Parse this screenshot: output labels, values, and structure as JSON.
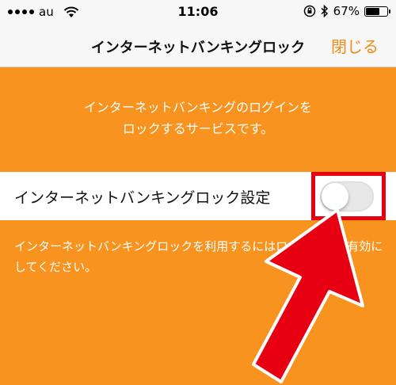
{
  "status_bar": {
    "carrier": "au",
    "time": "11:06",
    "battery_percent": "67%",
    "battery_level": 0.67,
    "icons": [
      "signal-icon",
      "wifi-icon",
      "orientation-lock-icon",
      "bluetooth-icon",
      "battery-icon"
    ]
  },
  "nav": {
    "title": "インターネットバンキングロック",
    "close_label": "閉じる"
  },
  "description": {
    "line1": "インターネットバンキングのログインを",
    "line2": "ロックするサービスです。"
  },
  "setting": {
    "label": "インターネットバンキングロック設定",
    "enabled": false
  },
  "note": {
    "text": "インターネットバンキングロックを利用するにはロック設定を有効にしてください。"
  },
  "colors": {
    "background": "#f7931e",
    "accent": "#f08a19",
    "highlight": "#e60012"
  }
}
